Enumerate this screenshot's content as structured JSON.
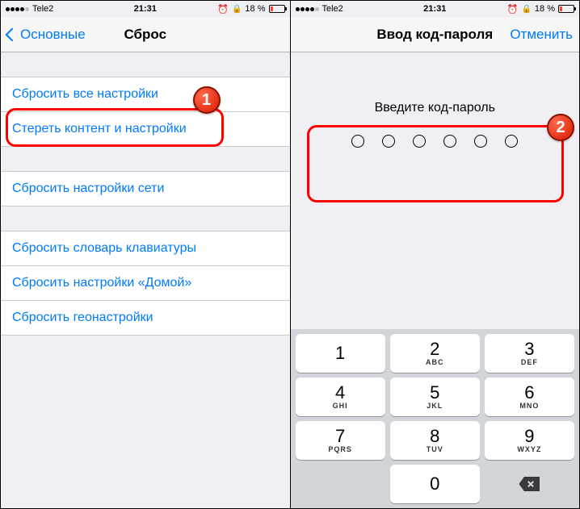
{
  "status": {
    "carrier": "Tele2",
    "time": "21:31",
    "battery_text": "18 %"
  },
  "left": {
    "back_label": "Основные",
    "title": "Сброс",
    "groups": [
      {
        "items": [
          {
            "label": "Сбросить все настройки"
          },
          {
            "label": "Стереть контент и настройки"
          }
        ]
      },
      {
        "items": [
          {
            "label": "Сбросить настройки сети"
          }
        ]
      },
      {
        "items": [
          {
            "label": "Сбросить словарь клавиатуры"
          },
          {
            "label": "Сбросить настройки «Домой»"
          },
          {
            "label": "Сбросить геонастройки"
          }
        ]
      }
    ],
    "step": "1"
  },
  "right": {
    "title": "Ввод код-пароля",
    "cancel": "Отменить",
    "prompt": "Введите код-пароль",
    "step": "2",
    "keypad": [
      {
        "num": "1",
        "let": ""
      },
      {
        "num": "2",
        "let": "ABC"
      },
      {
        "num": "3",
        "let": "DEF"
      },
      {
        "num": "4",
        "let": "GHI"
      },
      {
        "num": "5",
        "let": "JKL"
      },
      {
        "num": "6",
        "let": "MNO"
      },
      {
        "num": "7",
        "let": "PQRS"
      },
      {
        "num": "8",
        "let": "TUV"
      },
      {
        "num": "9",
        "let": "WXYZ"
      },
      {
        "num": "0",
        "let": ""
      }
    ]
  }
}
